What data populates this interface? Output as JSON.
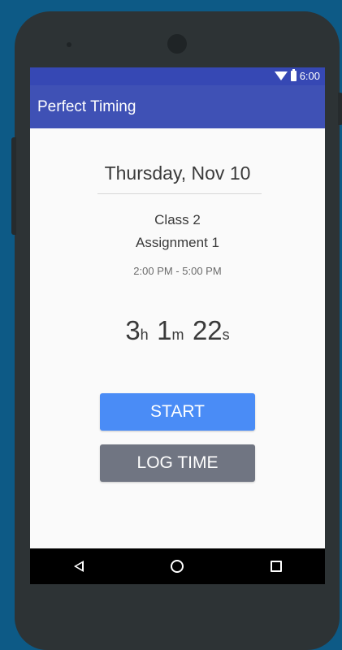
{
  "status_bar": {
    "time": "6:00"
  },
  "app_bar": {
    "title": "Perfect Timing"
  },
  "session": {
    "date": "Thursday, Nov 10",
    "class_name": "Class 2",
    "assignment": "Assignment 1",
    "time_range": "2:00 PM - 5:00 PM"
  },
  "timer": {
    "hours": "3",
    "hours_unit": "h",
    "minutes": "1",
    "minutes_unit": "m",
    "seconds": "22",
    "seconds_unit": "s"
  },
  "actions": {
    "start_label": "START",
    "log_time_label": "LOG TIME"
  },
  "colors": {
    "primary": "#3f51b5",
    "status_bar": "#3648b4",
    "start_button": "#4a8cf6",
    "log_button": "#707582"
  }
}
